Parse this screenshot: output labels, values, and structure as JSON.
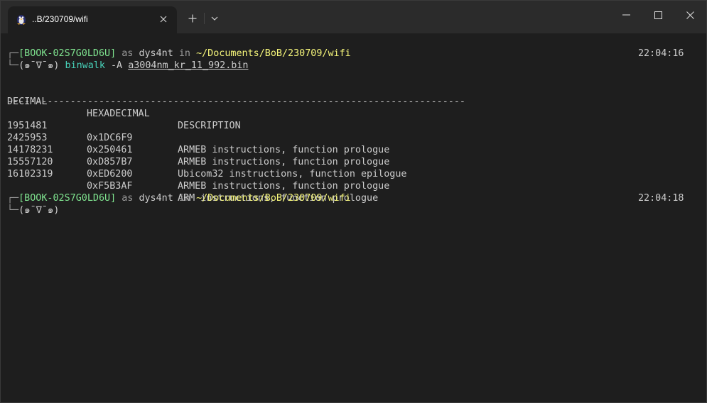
{
  "tab": {
    "title": "..B/230709/wifi",
    "icon": "linux-penguin-icon"
  },
  "prompt1": {
    "box_top": "┌─",
    "host": "[BOOK-02S7G0LD6U]",
    "as": "as",
    "user": "dys4nt",
    "in": "in",
    "path": "~/Documents/BoB/230709/wifi",
    "time": "22:04:16",
    "box_bottom": "└─",
    "face": "(๑ˉ∇ˉ๑)",
    "command": "binwalk",
    "flag": "-A",
    "arg": "a3004nm_kr_11_992.bin"
  },
  "table": {
    "headers": [
      "DECIMAL",
      "HEXADECIMAL",
      "DESCRIPTION"
    ],
    "separator": "--------------------------------------------------------------------------------",
    "rows": [
      [
        "1951481",
        "0x1DC6F9",
        "ARMEB instructions, function prologue"
      ],
      [
        "2425953",
        "0x250461",
        "ARMEB instructions, function prologue"
      ],
      [
        "14178231",
        "0xD857B7",
        "Ubicom32 instructions, function epilogue"
      ],
      [
        "15557120",
        "0xED6200",
        "ARMEB instructions, function prologue"
      ],
      [
        "16102319",
        "0xF5B3AF",
        "ARM instructions, function prologue"
      ]
    ]
  },
  "prompt2": {
    "box_top": "┌─",
    "host": "[BOOK-02S7G0LD6U]",
    "as": "as",
    "user": "dys4nt",
    "in": "in",
    "path": "~/Documents/BoB/230709/wifi",
    "time": "22:04:18",
    "box_bottom": "└─",
    "face": "(๑ˉ∇ˉ๑)"
  },
  "colors": {
    "background": "#1e1e1e",
    "titlebar": "#2b2b2b",
    "host": "#7fe38f",
    "path": "#f5f57a",
    "command": "#47d1b9"
  }
}
